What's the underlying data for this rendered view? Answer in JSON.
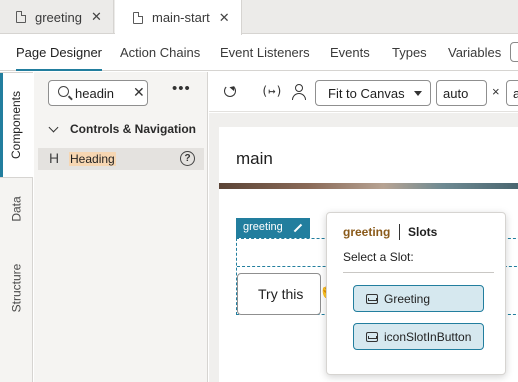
{
  "file_tabs": [
    {
      "label": "greeting"
    },
    {
      "label": "main-start"
    }
  ],
  "designer_tabs": [
    {
      "label": "Page Designer"
    },
    {
      "label": "Action Chains"
    },
    {
      "label": "Event Listeners"
    },
    {
      "label": "Events"
    },
    {
      "label": "Types"
    },
    {
      "label": "Variables"
    }
  ],
  "vertical_tabs": [
    {
      "label": "Components"
    },
    {
      "label": "Data"
    },
    {
      "label": "Structure"
    }
  ],
  "components_panel": {
    "search_value": "headin",
    "section_label": "Controls & Navigation",
    "component_label": "Heading",
    "component_icon_glyph": "H"
  },
  "toolbar": {
    "vars_label": "(↦)",
    "fit_label": "Fit to Canvas",
    "width_value": "auto",
    "times": "×",
    "height_value": "a"
  },
  "canvas": {
    "page_title": "main",
    "tag_label": "greeting",
    "try_label": "Try this"
  },
  "popup": {
    "context": "greeting",
    "title": "Slots",
    "subtitle": "Select a Slot:",
    "slots": [
      {
        "label": "Greeting"
      },
      {
        "label": "iconSlotInButton"
      }
    ]
  },
  "colors": {
    "accent": "#227e9e",
    "highlight": "#f6d6b2",
    "slot_bg": "#d6e8ef",
    "context_text": "#8a5a1a"
  }
}
